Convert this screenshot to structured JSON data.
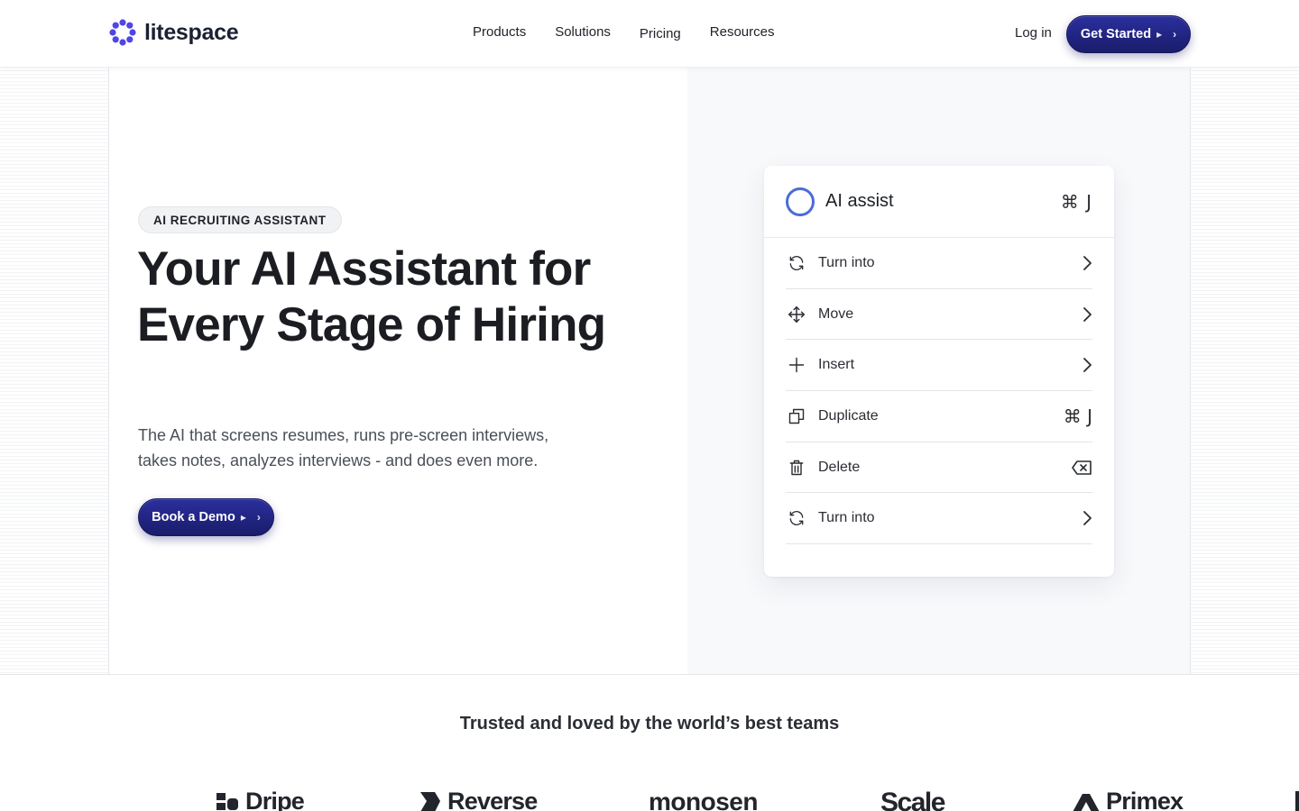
{
  "header": {
    "logo_text": "litespace",
    "nav": [
      "Products",
      "Solutions",
      "Pricing",
      "Resources"
    ],
    "login_label": "Log in",
    "cta_label": "Get Started"
  },
  "hero": {
    "badge": "AI RECRUITING ASSISTANT",
    "headline": "Your AI Assistant for Every Stage of Hiring",
    "subtext": "The AI that screens resumes, runs pre-screen interviews, takes notes, analyzes interviews - and does even more.",
    "cta_label": "Book a Demo"
  },
  "ai_card": {
    "title": "AI assist",
    "shortcut": "⌘ J",
    "items": [
      {
        "label": "Turn into",
        "icon": "refresh-icon",
        "end": "chevron"
      },
      {
        "label": "Move",
        "icon": "move-icon",
        "end": "chevron"
      },
      {
        "label": "Insert",
        "icon": "plus-icon",
        "end": "chevron"
      },
      {
        "label": "Duplicate",
        "icon": "copy-icon",
        "end": "⌘ J"
      },
      {
        "label": "Delete",
        "icon": "trash-icon",
        "end": "backspace"
      },
      {
        "label": "Turn into",
        "icon": "refresh-icon",
        "end": "chevron"
      }
    ]
  },
  "trusted": {
    "heading": "Trusted and loved by the world’s best teams",
    "brands": [
      "Dripe",
      "Reverse",
      "monosen",
      "Scale",
      "Primex"
    ]
  },
  "colors": {
    "primary": "#1f2180",
    "accent_ring": "#4b6cd6",
    "logo_mark": "#4f46e5"
  }
}
